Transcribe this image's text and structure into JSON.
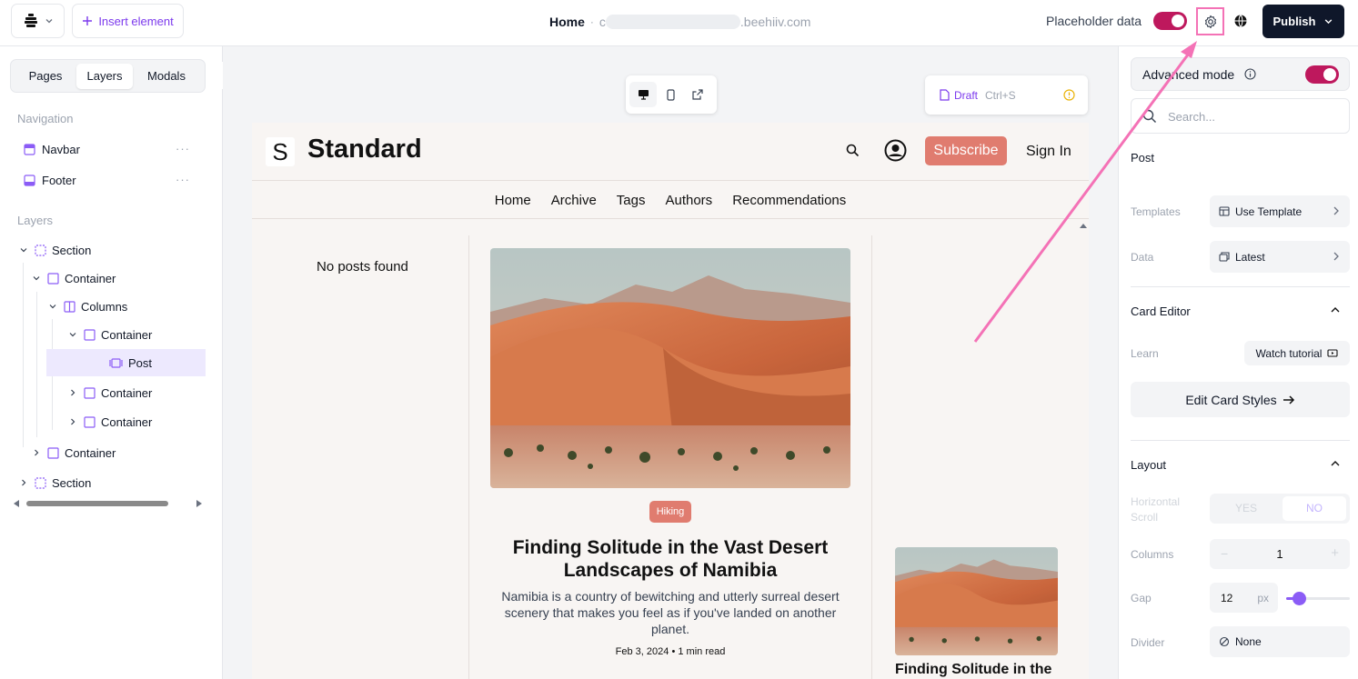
{
  "topbar": {
    "insert_label": "Insert element",
    "page_name": "Home",
    "separator": "·",
    "domain_prefix": "c",
    "domain_suffix": ".beehiiv.com",
    "placeholder_label": "Placeholder data",
    "placeholder_on": true,
    "publish_label": "Publish"
  },
  "left": {
    "tabs": [
      {
        "label": "Pages",
        "active": false
      },
      {
        "label": "Layers",
        "active": true
      },
      {
        "label": "Modals",
        "active": false
      }
    ],
    "navigation_title": "Navigation",
    "navigation_items": [
      {
        "label": "Navbar",
        "icon": "navbar-icon"
      },
      {
        "label": "Footer",
        "icon": "footer-icon"
      }
    ],
    "more_glyph": "···",
    "layers_title": "Layers",
    "layers": [
      {
        "label": "Section",
        "icon": "section-icon",
        "chevron": "down"
      },
      {
        "label": "Container",
        "icon": "container-icon",
        "chevron": "down"
      },
      {
        "label": "Columns",
        "icon": "columns-icon",
        "chevron": "down"
      },
      {
        "label": "Container",
        "icon": "container-icon",
        "chevron": "down"
      },
      {
        "label": "Post",
        "icon": "post-icon",
        "chevron": "none",
        "selected": true
      },
      {
        "label": "Container",
        "icon": "container-icon",
        "chevron": "right"
      },
      {
        "label": "Container",
        "icon": "container-icon",
        "chevron": "right"
      },
      {
        "label": "Container",
        "icon": "container-icon",
        "chevron": "right"
      },
      {
        "label": "Section",
        "icon": "section-icon",
        "chevron": "right"
      }
    ]
  },
  "canvas": {
    "draft_label": "Draft",
    "draft_shortcut": "Ctrl+S",
    "site": {
      "logo_letter": "S",
      "name": "Standard",
      "subscribe_label": "Subscribe",
      "signin_label": "Sign In",
      "nav": [
        "Home",
        "Archive",
        "Tags",
        "Authors",
        "Recommendations"
      ],
      "no_posts": "No posts found",
      "post": {
        "tag": "Hiking",
        "title": "Finding Solitude in the Vast Desert Landscapes of Namibia",
        "description": "Namibia is a country of bewitching and utterly surreal desert scenery that makes you feel as if you've landed on another planet.",
        "date": "Feb 3, 2024",
        "bullet": "•",
        "read_time": "1 min read"
      },
      "post2_title": "Finding Solitude in the"
    }
  },
  "right": {
    "advanced_label": "Advanced mode",
    "advanced_on": true,
    "search_placeholder": "Search...",
    "post_title": "Post",
    "templates_label": "Templates",
    "templates_value": "Use Template",
    "data_label": "Data",
    "data_value": "Latest",
    "card_editor_title": "Card Editor",
    "learn_label": "Learn",
    "watch_label": "Watch tutorial",
    "edit_styles_label": "Edit Card Styles",
    "layout_title": "Layout",
    "hscroll_label_1": "Horizontal",
    "hscroll_label_2": "Scroll",
    "yes_label": "YES",
    "no_label": "NO",
    "columns_label": "Columns",
    "columns_value": "1",
    "minus": "−",
    "plus": "+",
    "gap_label": "Gap",
    "gap_value": "12",
    "gap_unit": "px",
    "gap_slider_fraction": 0.2,
    "divider_label": "Divider",
    "divider_value": "None"
  },
  "colors": {
    "accent": "#7c3aed",
    "toggle": "#be185d",
    "brand": "#e07c6f",
    "highlight": "#f472b6"
  }
}
